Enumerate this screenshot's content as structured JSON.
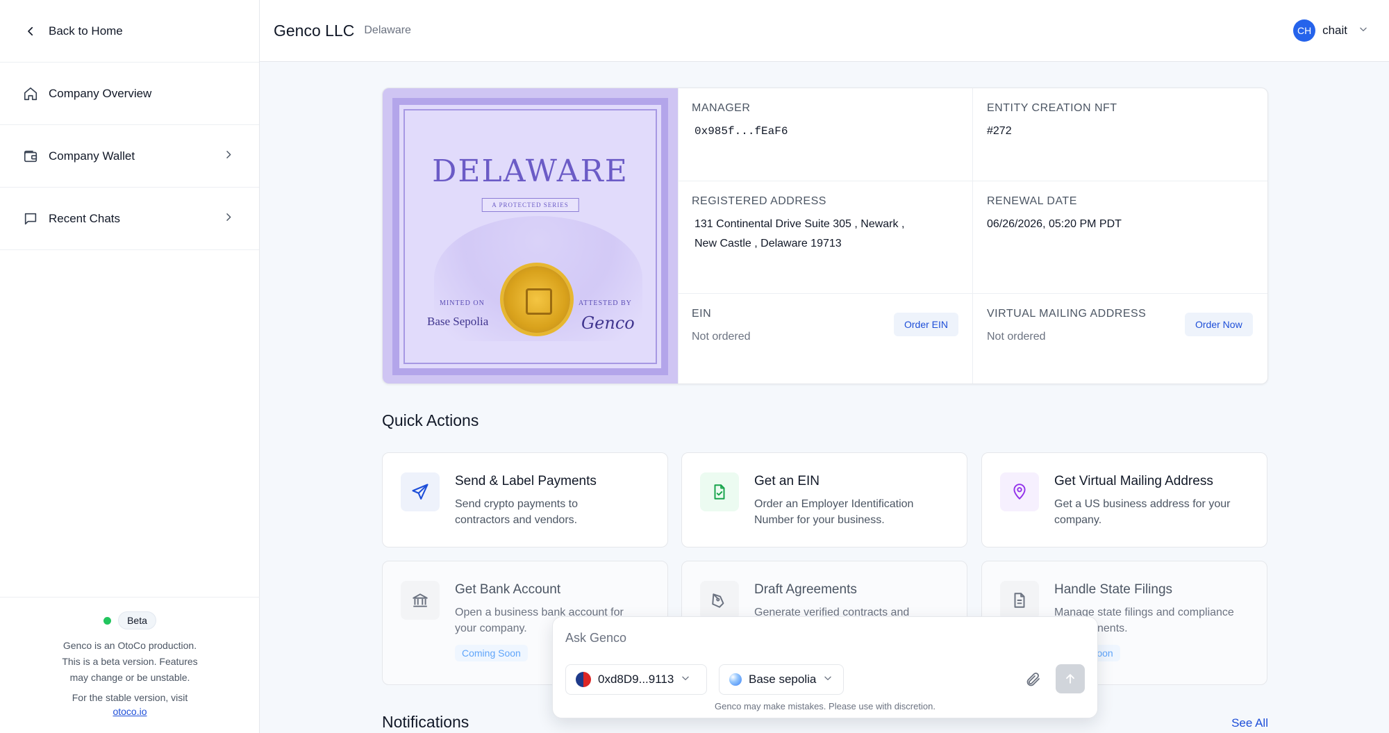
{
  "sidebar": {
    "back_label": "Back to Home",
    "items": [
      {
        "label": "Company Overview"
      },
      {
        "label": "Company Wallet"
      },
      {
        "label": "Recent Chats"
      }
    ],
    "footer": {
      "badge": "Beta",
      "line1": "Genco is an OtoCo production.",
      "line2": "This is a beta version. Features",
      "line3": "may change or be unstable.",
      "line4": "For the stable version, visit",
      "link": "otoco.io"
    }
  },
  "header": {
    "title": "Genco LLC",
    "subtitle": "Delaware",
    "user_initials": "CH",
    "user_name": "chait"
  },
  "certificate": {
    "title": "DELAWARE",
    "banner": "A PROTECTED SERIES",
    "minted_label": "MINTED ON",
    "minted_value": "Base Sepolia",
    "attested_label": "ATTESTED BY",
    "attested_sign": "Genco"
  },
  "entity": {
    "manager_label": "MANAGER",
    "manager_value": "0x985f...fEaF6",
    "nft_label": "ENTITY CREATION NFT",
    "nft_value": "#272",
    "address_label": "REGISTERED ADDRESS",
    "address_line1": "131 Continental Drive Suite 305 , Newark ,",
    "address_line2": "New Castle , Delaware 19713",
    "renewal_label": "RENEWAL DATE",
    "renewal_value": "06/26/2026, 05:20 PM PDT",
    "ein_label": "EIN",
    "ein_value": "Not ordered",
    "ein_button": "Order EIN",
    "mail_label": "VIRTUAL MAILING ADDRESS",
    "mail_value": "Not ordered",
    "mail_button": "Order Now"
  },
  "quick_actions": {
    "title": "Quick Actions",
    "cards": [
      {
        "title": "Send & Label Payments",
        "desc1": "Send crypto payments to",
        "desc2": "contractors and vendors."
      },
      {
        "title": "Get an EIN",
        "desc1": "Order an Employer Identification",
        "desc2": "Number for your business."
      },
      {
        "title": "Get Virtual Mailing Address",
        "desc1": "Get a US business address for your",
        "desc2": "company."
      },
      {
        "title": "Get Bank Account",
        "desc1": "Open a business bank account for",
        "desc2": "your company.",
        "badge": "Coming Soon"
      },
      {
        "title": "Draft Agreements",
        "desc1": "Generate verified contracts and",
        "desc2": ""
      },
      {
        "title": "Handle State Filings",
        "desc1": "Manage state filings and compliance",
        "desc2": "nents.",
        "badge": "Soon"
      }
    ]
  },
  "notifications": {
    "title": "Notifications",
    "see_all": "See All"
  },
  "chat": {
    "placeholder": "Ask Genco",
    "wallet": "0xd8D9...9113",
    "network": "Base sepolia",
    "disclaimer": "Genco may make mistakes. Please use with discretion."
  },
  "colors": {
    "accent": "#2563eb",
    "link": "#1d4ed8",
    "certificate": "#cfc5f3",
    "beta_dot": "#22c55e"
  }
}
